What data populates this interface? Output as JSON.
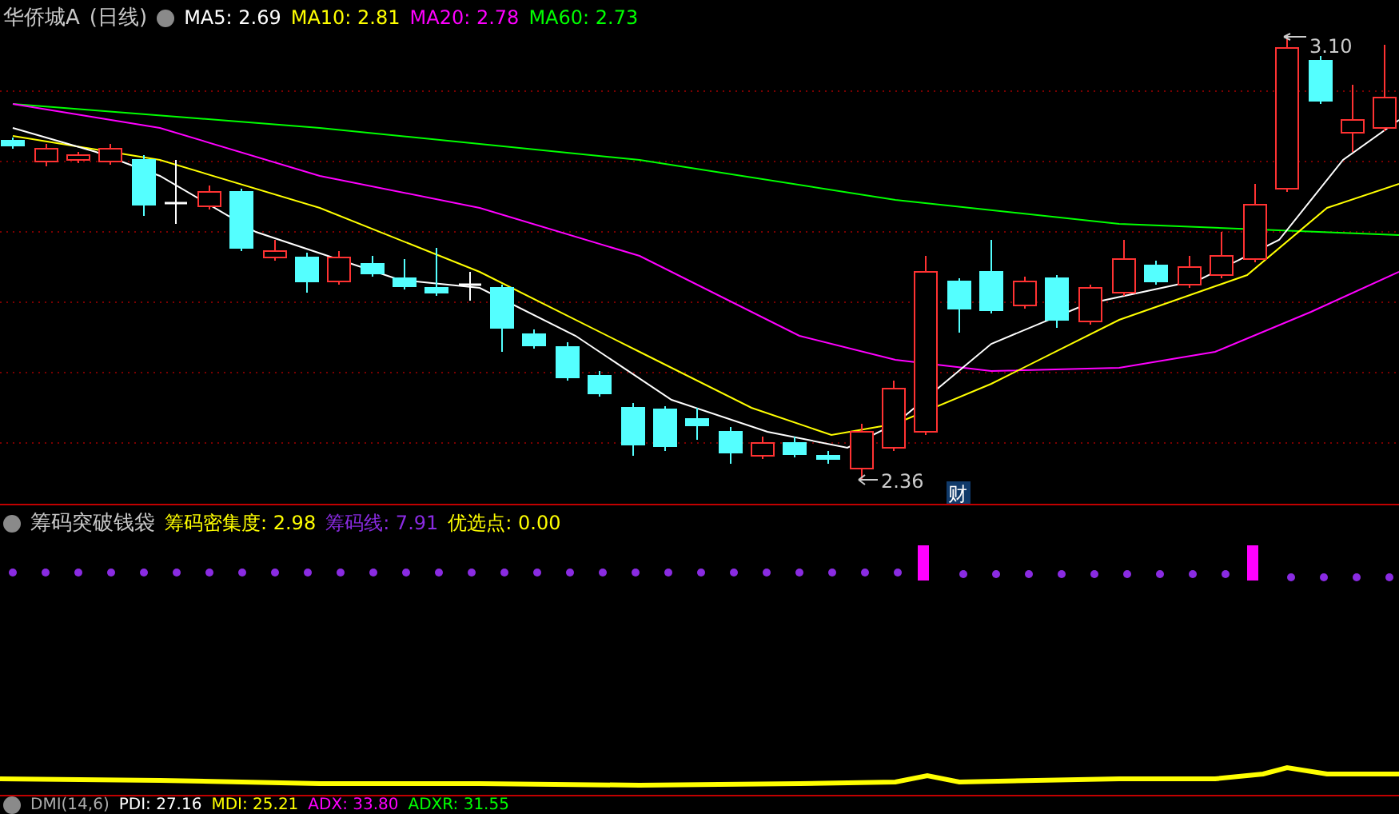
{
  "main_panel": {
    "title": "华侨城A",
    "period": "(日线)",
    "indicators": [
      {
        "label": "MA5: 2.69",
        "color": "#ffffff"
      },
      {
        "label": "MA10: 2.81",
        "color": "#ffff00"
      },
      {
        "label": "MA20: 2.78",
        "color": "#ff00ff"
      },
      {
        "label": "MA60: 2.73",
        "color": "#00ff00"
      }
    ],
    "high_label": "3.10",
    "low_label": "2.36",
    "news_badge": "财"
  },
  "indicator_panel": {
    "name": "筹码突破钱袋",
    "values": [
      {
        "label": "筹码密集度: 2.98",
        "color": "#ffff00"
      },
      {
        "label": "筹码线: 7.91",
        "color": "#8a2be2"
      },
      {
        "label": "优选点: 0.00",
        "color": "#ffff00"
      }
    ]
  },
  "dmi_panel": {
    "name": "DMI(14,6)",
    "values": [
      {
        "label": "PDI: 27.16",
        "color": "#ffffff"
      },
      {
        "label": "MDI: 25.21",
        "color": "#ffff00"
      },
      {
        "label": "ADX: 33.80",
        "color": "#ff00ff"
      },
      {
        "label": "ADXR: 31.55",
        "color": "#00ff00"
      }
    ]
  }
}
